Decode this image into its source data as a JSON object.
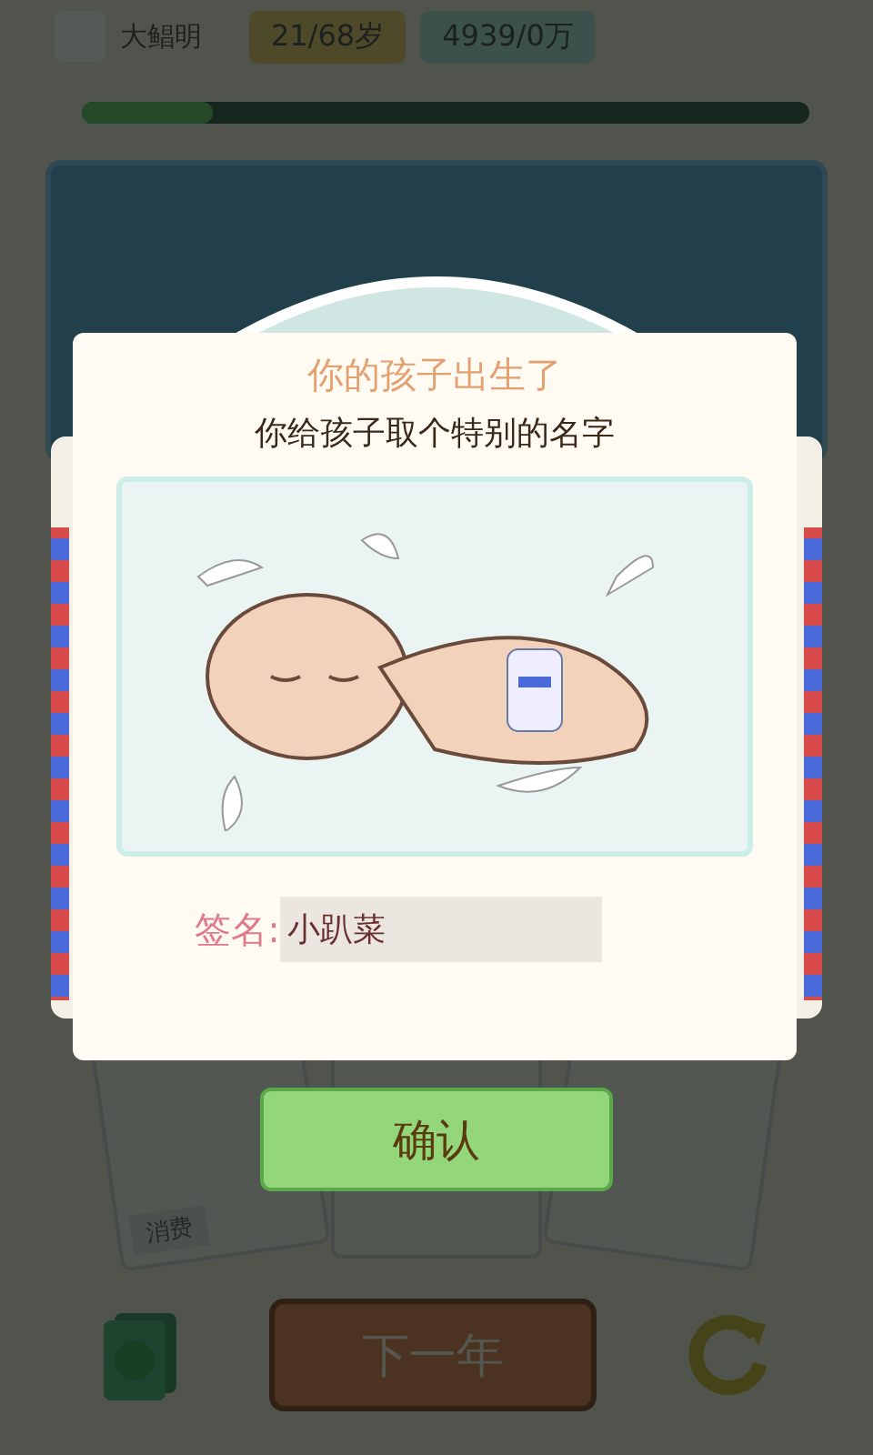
{
  "header": {
    "name": "大鲳明",
    "age": "21/68岁",
    "money": "4939/0万"
  },
  "progress": {
    "level": 0.18
  },
  "cards": [
    {
      "label": "消费"
    }
  ],
  "next_button": "下一年",
  "dialog": {
    "title": "你的孩子出生了",
    "subtitle": "你给孩子取个特别的名字",
    "name_label": "签名:",
    "name_value": "小趴菜",
    "confirm": "确认"
  }
}
